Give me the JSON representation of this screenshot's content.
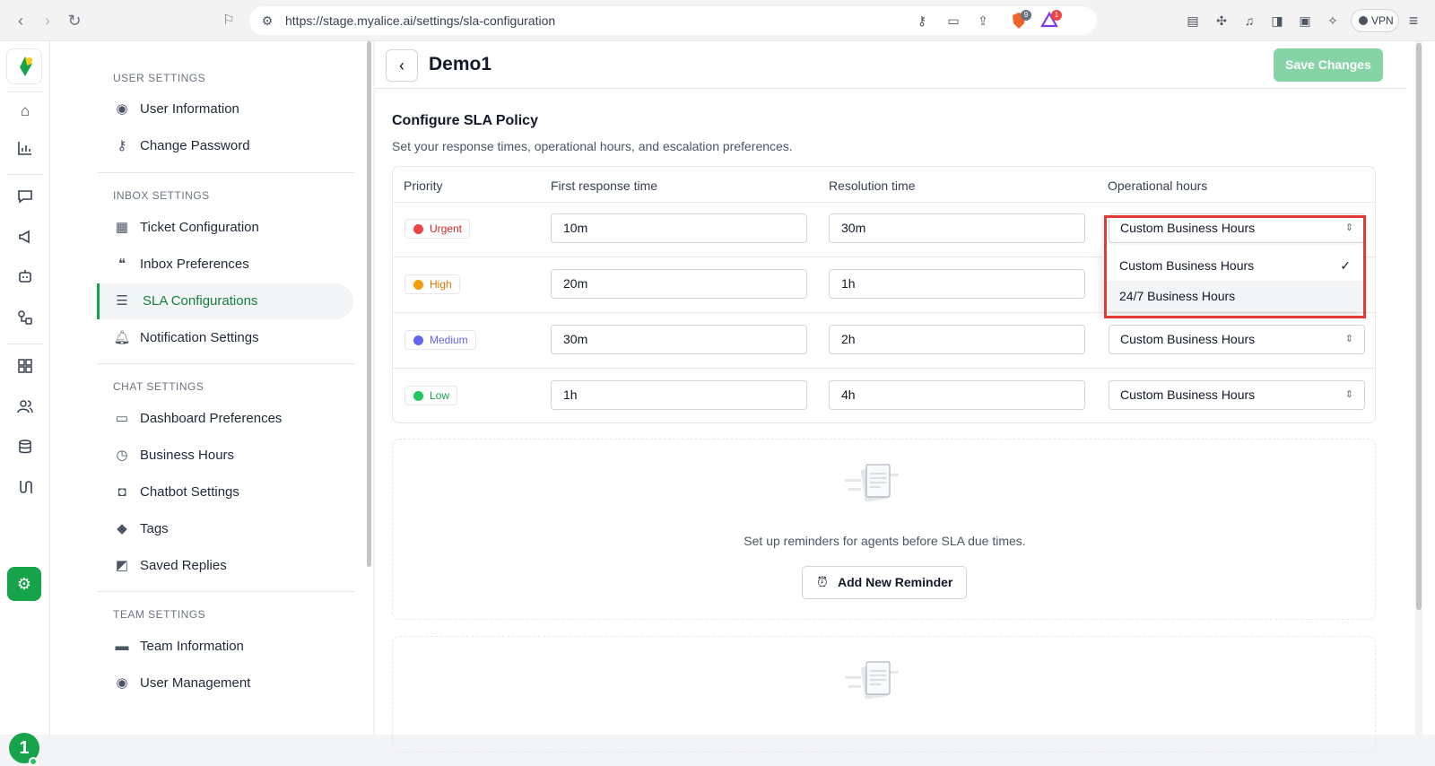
{
  "browser": {
    "url": "https://stage.myalice.ai/settings/sla-configuration",
    "vpn_label": "VPN",
    "brave_badge": "9",
    "alert_badge": "1"
  },
  "rail": {
    "avatar_initial": "1"
  },
  "settings_nav": {
    "sections": [
      {
        "title": "USER SETTINGS",
        "items": [
          "User Information",
          "Change Password"
        ]
      },
      {
        "title": "INBOX SETTINGS",
        "items": [
          "Ticket Configuration",
          "Inbox Preferences",
          "SLA Configurations",
          "Notification Settings"
        ]
      },
      {
        "title": "CHAT SETTINGS",
        "items": [
          "Dashboard Preferences",
          "Business Hours",
          "Chatbot Settings",
          "Tags",
          "Saved Replies"
        ]
      },
      {
        "title": "TEAM SETTINGS",
        "items": [
          "Team Information",
          "User Management"
        ]
      }
    ],
    "active_item": "SLA Configurations"
  },
  "header": {
    "title": "Demo1",
    "save_label": "Save Changes"
  },
  "sla": {
    "title": "Configure SLA Policy",
    "subtitle": "Set your response times, operational hours, and escalation preferences.",
    "columns": [
      "Priority",
      "First response time",
      "Resolution time",
      "Operational hours"
    ],
    "rows": [
      {
        "priority": "Urgent",
        "color": "#ef4444",
        "text_color": "#dc2626",
        "first_response": "10m",
        "resolution": "30m",
        "hours": "Custom Business Hours"
      },
      {
        "priority": "High",
        "color": "#f59e0b",
        "text_color": "#d97706",
        "first_response": "20m",
        "resolution": "1h",
        "hours": ""
      },
      {
        "priority": "Medium",
        "color": "#6366f1",
        "text_color": "#6366f1",
        "first_response": "30m",
        "resolution": "2h",
        "hours": "Custom Business Hours"
      },
      {
        "priority": "Low",
        "color": "#22c55e",
        "text_color": "#16a34a",
        "first_response": "1h",
        "resolution": "4h",
        "hours": "Custom Business Hours"
      }
    ],
    "dropdown_options": [
      "Custom Business Hours",
      "24/7 Business Hours"
    ],
    "dropdown_selected": "Custom Business Hours"
  },
  "reminders": {
    "empty_text": "Set up reminders for agents before SLA due times.",
    "add_label": "Add New Reminder"
  },
  "colors": {
    "accent": "#16a34a",
    "save_disabled": "#86d4a6",
    "highlight": "#e53935"
  }
}
